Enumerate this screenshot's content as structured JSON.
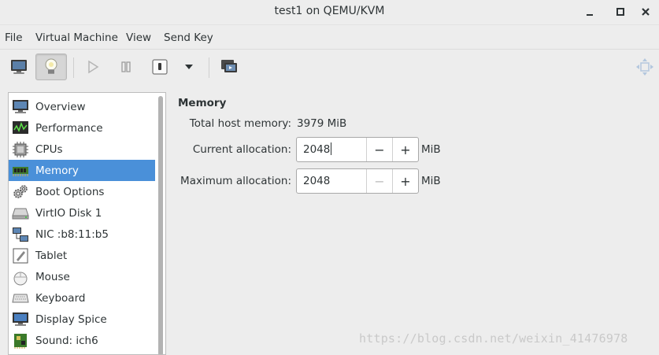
{
  "window": {
    "title": "test1 on QEMU/KVM",
    "controls": [
      "minimize-icon",
      "maximize-icon",
      "close-icon"
    ]
  },
  "menubar": {
    "items": [
      "File",
      "Virtual Machine",
      "View",
      "Send Key"
    ]
  },
  "toolbar": {
    "buttons": [
      {
        "icon": "monitor-icon",
        "state": "normal"
      },
      {
        "icon": "lightbulb-icon",
        "state": "pressed"
      },
      {
        "icon": "play-icon",
        "state": "disabled"
      },
      {
        "icon": "pause-icon",
        "state": "disabled"
      },
      {
        "icon": "power-icon",
        "state": "normal"
      },
      {
        "icon": "chevron-down-icon",
        "state": "normal"
      },
      {
        "icon": "snapshots-icon",
        "state": "normal"
      },
      {
        "icon": "fullscreen-move-icon",
        "state": "disabled"
      }
    ]
  },
  "sidebar": {
    "selected_index": 3,
    "items": [
      {
        "label": "Overview",
        "icon": "monitor-icon"
      },
      {
        "label": "Performance",
        "icon": "performance-graph-icon"
      },
      {
        "label": "CPUs",
        "icon": "cpu-chip-icon"
      },
      {
        "label": "Memory",
        "icon": "memory-module-icon"
      },
      {
        "label": "Boot Options",
        "icon": "gears-icon"
      },
      {
        "label": "VirtIO Disk 1",
        "icon": "disk-drive-icon"
      },
      {
        "label": "NIC :b8:11:b5",
        "icon": "network-icon"
      },
      {
        "label": "Tablet",
        "icon": "tablet-icon"
      },
      {
        "label": "Mouse",
        "icon": "mouse-icon"
      },
      {
        "label": "Keyboard",
        "icon": "keyboard-icon"
      },
      {
        "label": "Display Spice",
        "icon": "display-icon"
      },
      {
        "label": "Sound: ich6",
        "icon": "sound-card-icon"
      }
    ]
  },
  "memory": {
    "section_title": "Memory",
    "total_host_label": "Total host memory:",
    "total_host_value": "3979 MiB",
    "current_label": "Current allocation:",
    "current_value": "2048",
    "current_unit": "MiB",
    "maximum_label": "Maximum allocation:",
    "maximum_value": "2048",
    "maximum_unit": "MiB",
    "minus_symbol": "−",
    "plus_symbol": "+"
  },
  "watermark": "https://blog.csdn.net/weixin_41476978",
  "colors": {
    "selection": "#4a90d9",
    "background": "#ededed",
    "text": "#2e3436"
  }
}
